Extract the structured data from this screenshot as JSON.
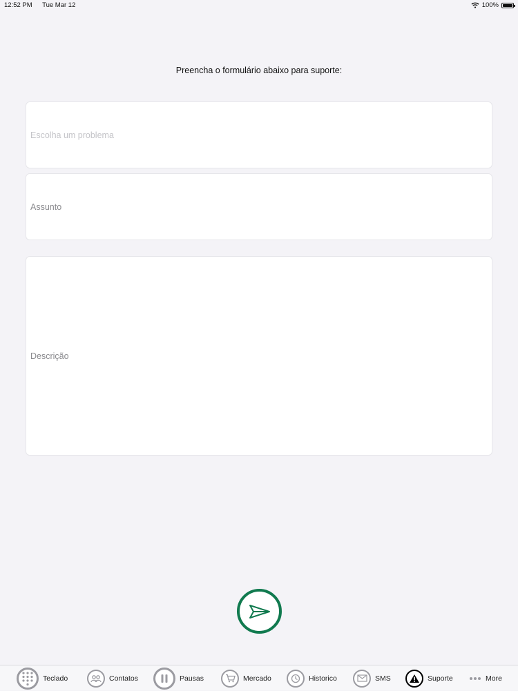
{
  "status_bar": {
    "time": "12:52 PM",
    "date": "Tue Mar 12",
    "battery": "100%"
  },
  "form": {
    "title": "Preencha o formulário abaixo para suporte:",
    "problem_placeholder": "Escolha um problema",
    "subject_label": "Assunto",
    "description_label": "Descrição"
  },
  "tabs": [
    {
      "label": "Teclado",
      "icon": "keypad-icon"
    },
    {
      "label": "Contatos",
      "icon": "contacts-icon"
    },
    {
      "label": "Pausas",
      "icon": "pause-icon"
    },
    {
      "label": "Mercado",
      "icon": "cart-icon"
    },
    {
      "label": "Historico",
      "icon": "clock-icon"
    },
    {
      "label": "SMS",
      "icon": "envelope-icon"
    },
    {
      "label": "Suporte",
      "icon": "warning-icon",
      "active": true
    },
    {
      "label": "More",
      "icon": "more-icon"
    }
  ],
  "colors": {
    "accent": "#117a4f",
    "background": "#f4f3f7",
    "tab_icon_border": "#9b9ba1"
  }
}
